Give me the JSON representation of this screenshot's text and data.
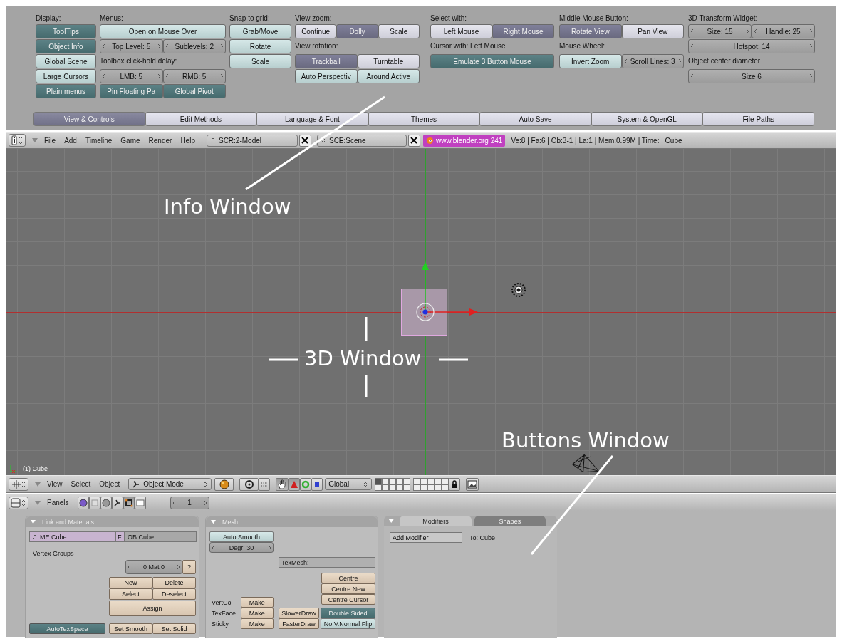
{
  "preferences": {
    "columns": [
      {
        "heading": "Display:",
        "rows": [
          [
            {
              "kind": "toggle",
              "label": "ToolTips",
              "on": true
            }
          ],
          [
            {
              "kind": "toggle",
              "label": "Object Info",
              "on": true
            }
          ],
          [
            {
              "kind": "toggle",
              "label": "Global Scene",
              "on": false
            }
          ],
          [
            {
              "kind": "toggle",
              "label": "Large Cursors",
              "on": false
            }
          ],
          [
            {
              "kind": "toggle",
              "label": "Plain menus",
              "on": true
            }
          ]
        ]
      },
      {
        "heading": "Menus:",
        "rows": [
          [
            {
              "kind": "toggle",
              "label": "Open on Mouse Over",
              "on": false
            }
          ],
          [
            {
              "kind": "number",
              "label": "Top Level: 5"
            },
            {
              "kind": "number",
              "label": "Sublevels: 2"
            }
          ],
          [
            {
              "kind": "label",
              "text": "Toolbox click-hold delay:"
            }
          ],
          [
            {
              "kind": "number",
              "label": "LMB: 5"
            },
            {
              "kind": "number",
              "label": "RMB: 5"
            }
          ],
          [
            {
              "kind": "toggle",
              "label": "Pin Floating Pa",
              "on": true
            },
            {
              "kind": "toggle",
              "label": "Global Pivot",
              "on": true
            }
          ]
        ]
      },
      {
        "heading": "Snap to grid:",
        "rows": [
          [
            {
              "kind": "push",
              "label": "Grab/Move"
            }
          ],
          [
            {
              "kind": "push",
              "label": "Rotate"
            }
          ],
          [
            {
              "kind": "push",
              "label": "Scale"
            }
          ]
        ]
      },
      {
        "heading": "View zoom:",
        "rows": [
          [
            {
              "kind": "radio",
              "label": "Continue",
              "selected": false
            },
            {
              "kind": "radio",
              "label": "Dolly",
              "selected": true
            },
            {
              "kind": "radio",
              "label": "Scale",
              "selected": false
            }
          ],
          [
            {
              "kind": "label",
              "text": "View rotation:"
            }
          ],
          [
            {
              "kind": "radio",
              "label": "Trackball",
              "selected": true
            },
            {
              "kind": "radio",
              "label": "Turntable",
              "selected": false
            }
          ],
          [
            {
              "kind": "toggle",
              "label": "Auto Perspectiv",
              "on": false
            },
            {
              "kind": "toggle",
              "label": "Around Active",
              "on": false
            }
          ]
        ]
      },
      {
        "heading": "Select with:",
        "rows": [
          [
            {
              "kind": "radio",
              "label": "Left Mouse",
              "selected": false
            },
            {
              "kind": "radio",
              "label": "Right Mouse",
              "selected": true
            }
          ],
          [
            {
              "kind": "label",
              "text": "Cursor with: Left Mouse"
            }
          ],
          [
            {
              "kind": "toggle",
              "label": "Emulate 3 Button Mouse",
              "on": true
            }
          ]
        ]
      },
      {
        "heading": "Middle Mouse Button:",
        "rows": [
          [
            {
              "kind": "radio",
              "label": "Rotate View",
              "selected": true
            },
            {
              "kind": "radio",
              "label": "Pan View",
              "selected": false
            }
          ],
          [
            {
              "kind": "label",
              "text": "Mouse Wheel:"
            }
          ],
          [
            {
              "kind": "toggle",
              "label": "Invert Zoom",
              "on": false
            },
            {
              "kind": "number",
              "label": "Scroll Lines: 3"
            }
          ]
        ]
      },
      {
        "heading": "3D Transform Widget:",
        "rows": [
          [
            {
              "kind": "number",
              "label": "Size: 15"
            },
            {
              "kind": "number",
              "label": "Handle: 25"
            }
          ],
          [
            {
              "kind": "number",
              "label": "Hotspot: 14"
            }
          ],
          [
            {
              "kind": "label",
              "text": "Object center diameter"
            }
          ],
          [
            {
              "kind": "number",
              "label": "Size 6"
            }
          ]
        ]
      }
    ]
  },
  "tabs": [
    {
      "label": "View & Controls",
      "selected": true
    },
    {
      "label": "Edit Methods",
      "selected": false
    },
    {
      "label": "Language & Font",
      "selected": false
    },
    {
      "label": "Themes",
      "selected": false
    },
    {
      "label": "Auto Save",
      "selected": false
    },
    {
      "label": "System & OpenGL",
      "selected": false
    },
    {
      "label": "File Paths",
      "selected": false
    }
  ],
  "info_header": {
    "menus": [
      "File",
      "Add",
      "Timeline",
      "Game",
      "Render",
      "Help"
    ],
    "screen": "SCR:2-Model",
    "scene": "SCE:Scene",
    "link": "www.blender.org 241",
    "stats": "Ve:8 | Fa:6 | Ob:3-1 | La:1 | Mem:0.99M | Time: | Cube"
  },
  "viewport": {
    "object_label": "(1) Cube"
  },
  "annotations": [
    {
      "text": "Info Window"
    },
    {
      "text": "3D Window"
    },
    {
      "text": "Buttons Window"
    }
  ],
  "view_header": {
    "menus": [
      "View",
      "Select",
      "Object"
    ],
    "mode": "Object Mode",
    "orientation": "Global"
  },
  "buttons_header": {
    "label": "Panels",
    "frame": "1"
  },
  "link_panel": {
    "title": "Link and Materials",
    "mesh": "ME:Cube",
    "f": "F",
    "object": "OB:Cube",
    "vertex_groups": "Vertex Groups",
    "material": "0 Mat 0",
    "help": "?",
    "buttons": [
      "New",
      "Delete",
      "Select",
      "Deselect"
    ],
    "assign": "Assign",
    "autotexspace": {
      "label": "AutoTexSpace",
      "on": true
    },
    "shading": [
      "Set Smooth",
      "Set Solid"
    ]
  },
  "mesh_panel": {
    "title": "Mesh",
    "auto_smooth": {
      "label": "Auto Smooth",
      "on": false
    },
    "degree": "Degr: 30",
    "texmesh": "TexMesh:",
    "centre": [
      "Centre",
      "Centre New",
      "Centre Cursor"
    ],
    "layers": [
      {
        "name": "VertCol",
        "button": "Make"
      },
      {
        "name": "TexFace",
        "button": "Make"
      },
      {
        "name": "Sticky",
        "button": "Make"
      }
    ],
    "draw": [
      "SlowerDraw",
      "FasterDraw"
    ],
    "double_sided": {
      "label": "Double Sided",
      "on": true
    },
    "normal_flip": {
      "label": "No V.Normal Flip",
      "on": false
    }
  },
  "modifiers_panel": {
    "tabs": [
      {
        "label": "Modifiers",
        "selected": true
      },
      {
        "label": "Shapes",
        "selected": false
      }
    ],
    "add": "Add Modifier",
    "target": "To: Cube"
  }
}
